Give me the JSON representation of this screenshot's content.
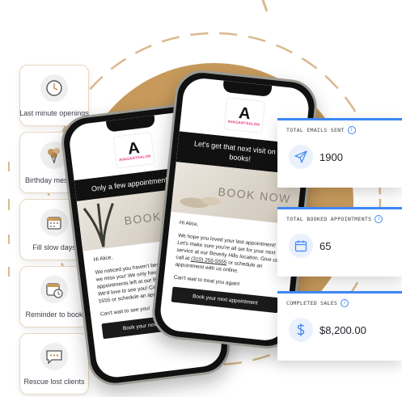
{
  "automations": [
    {
      "label": "Last minute openings",
      "icon": "clock-icon"
    },
    {
      "label": "Birthday message",
      "icon": "balloons-icon"
    },
    {
      "label": "Fill slow days",
      "icon": "calendar-grid-icon"
    },
    {
      "label": "Reminder to book",
      "icon": "calendar-clock-icon"
    },
    {
      "label": "Rescue lost clients",
      "icon": "chat-bubble-icon"
    }
  ],
  "phone_back": {
    "logo_letter": "A",
    "brand": "AVAGANTSALON",
    "banner": "Only a few appointments left!",
    "hero_text": "BOOK NOW",
    "greeting": "Hi Alice,",
    "body": "We noticed you haven't been in for a bit and we miss you! We only have a few appointments left at our Beverly Hills location. We'd love to see you! Call us at (310) 255-5555 or schedule an appointment online.",
    "signoff": "Can't wait to see you!",
    "cta": "Book your next appointment"
  },
  "phone_front": {
    "logo_letter": "A",
    "brand": "AVAGANTSALON",
    "banner": "Let's get that next visit on the books!",
    "hero_text": "BOOK NOW",
    "greeting": "Hi Alice,",
    "body_pre": "We hope you loved your last appointment! Let's make sure you're all set for your next service at our Beverly Hills location. Give us a call at ",
    "phone": "(310) 255-5555",
    "body_post": " or schedule an appointment with us online.",
    "signoff": "Can't wait to treat you again!",
    "cta": "Book your next appointment"
  },
  "stats": [
    {
      "title": "TOTAL EMAILS SENT",
      "value": "1900",
      "icon": "paper-plane-icon"
    },
    {
      "title": "TOTAL BOOKED APPOINTMENTS",
      "value": "65",
      "icon": "calendar-icon"
    },
    {
      "title": "COMPLETED SALES",
      "value": "$8,200.00",
      "icon": "dollar-icon"
    }
  ],
  "colors": {
    "accent": "#3d87f5",
    "gold_circle": "#c79a5c",
    "dash": "#d9b98d",
    "brand_pink": "#e8337d"
  }
}
